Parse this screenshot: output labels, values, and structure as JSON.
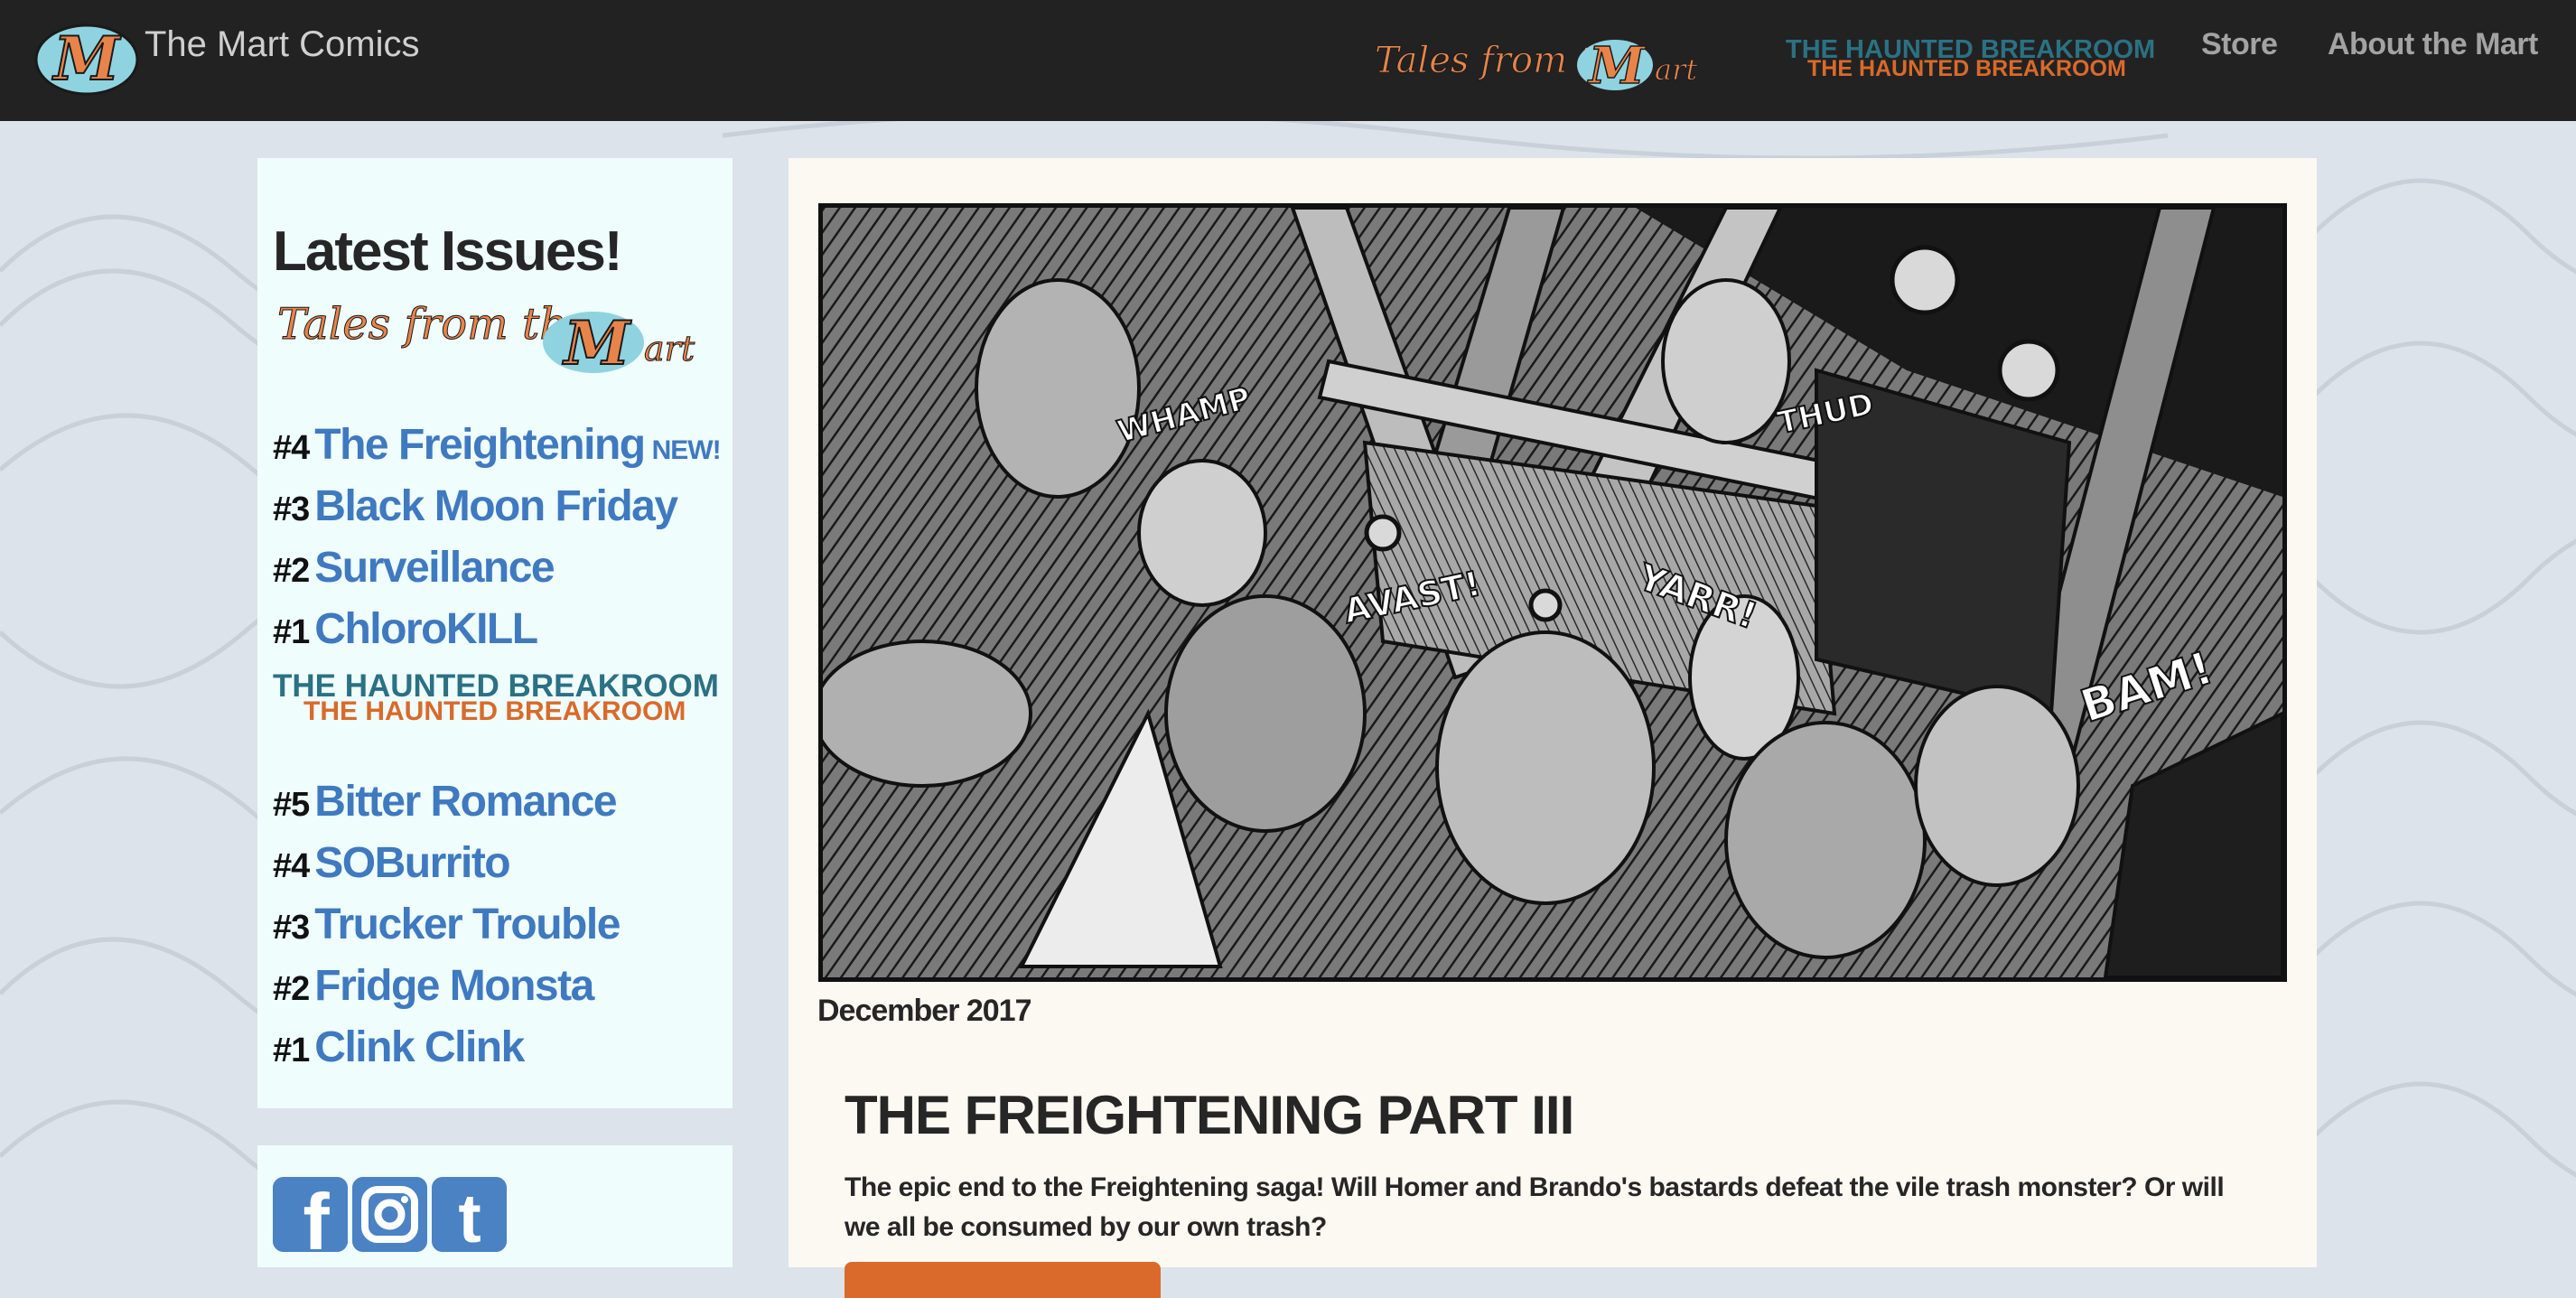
{
  "navbar": {
    "brand_logo_letter": "M",
    "brand_title": "The Mart Comics",
    "tales_logo_text": "Tales from the",
    "tales_logo_letter": "M",
    "tales_logo_suffix": "art",
    "haunted_logo_text": "THE HAUNTED BREAKROOM",
    "links": {
      "store": "Store",
      "about": "About the Mart"
    }
  },
  "sidebar": {
    "heading": "Latest Issues!",
    "tales_logo_text": "Tales from the",
    "tales_logo_letter": "M",
    "tales_logo_suffix": "art",
    "tales_issues": [
      {
        "num": "#4",
        "title": "The Freightening",
        "badge": "NEW!"
      },
      {
        "num": "#3",
        "title": "Black Moon Friday"
      },
      {
        "num": "#2",
        "title": "Surveillance"
      },
      {
        "num": "#1",
        "title": "ChloroKILL"
      }
    ],
    "haunted_logo_text": "THE HAUNTED BREAKROOM",
    "haunted_issues": [
      {
        "num": "#5",
        "title": "Bitter Romance"
      },
      {
        "num": "#4",
        "title": "SOBurrito"
      },
      {
        "num": "#3",
        "title": "Trucker Trouble"
      },
      {
        "num": "#2",
        "title": "Fridge Monsta"
      },
      {
        "num": "#1",
        "title": "Clink Clink"
      }
    ]
  },
  "social": {
    "facebook_glyph": "f",
    "tumblr_glyph": "t"
  },
  "main": {
    "comic_sfx": {
      "whamp": "WHAMP",
      "avast": "AVAST!",
      "yarr": "YARR!",
      "thud": "THUD",
      "bam": "BAM!"
    },
    "comic_date": "December 2017",
    "post_title": "THE FREIGHTENING PART III",
    "post_body": "The epic end to the Freightening saga! Will Homer and Brando's bastards defeat the vile trash monster? Or will we all be consumed by our own trash?"
  },
  "colors": {
    "navbar_bg": "#222222",
    "link_blue": "#3f79c0",
    "logo_orange": "#e8844a",
    "haunted_teal": "#2b7183",
    "haunted_orange": "#d96a2b",
    "sidebar_bg": "#effdfc",
    "main_bg": "#fcf8f2",
    "social_blue": "#4a82c4"
  }
}
